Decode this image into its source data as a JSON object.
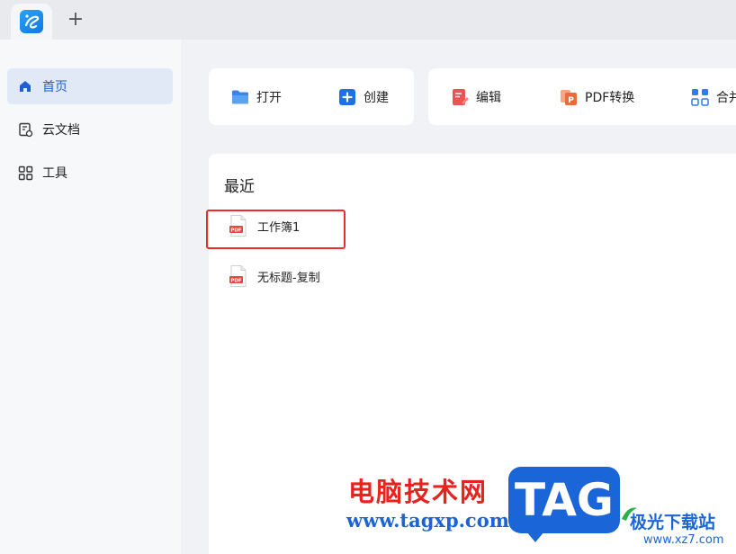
{
  "titlebar": {
    "new_tab_label": "+"
  },
  "sidebar": {
    "items": [
      {
        "label": "首页",
        "icon": "home-icon",
        "active": true
      },
      {
        "label": "云文档",
        "icon": "cloud-doc-icon",
        "active": false
      },
      {
        "label": "工具",
        "icon": "tools-grid-icon",
        "active": false
      }
    ]
  },
  "quick_actions": [
    {
      "label": "打开",
      "icon": "folder-open-icon"
    },
    {
      "label": "创建",
      "icon": "plus-square-icon"
    },
    {
      "label": "编辑",
      "icon": "edit-doc-icon"
    },
    {
      "label": "PDF转换",
      "icon": "pdf-convert-icon"
    },
    {
      "label": "合并",
      "icon": "merge-icon"
    }
  ],
  "recent": {
    "title": "最近",
    "files": [
      {
        "name": "工作簿1",
        "icon": "pdf-file-icon"
      },
      {
        "name": "无标题-复制",
        "icon": "pdf-file-icon"
      }
    ]
  },
  "watermark": {
    "cn_text": "电脑技术网",
    "url": "www.tagxp.com",
    "tag": "TAG",
    "site_cn": "极光下载站",
    "site_url": "www.xz7.com"
  },
  "colors": {
    "accent": "#1f5fd6",
    "active_nav_bg": "#e1e9f6",
    "highlight_border": "#e5302a",
    "pdf_red": "#e04a3f"
  }
}
